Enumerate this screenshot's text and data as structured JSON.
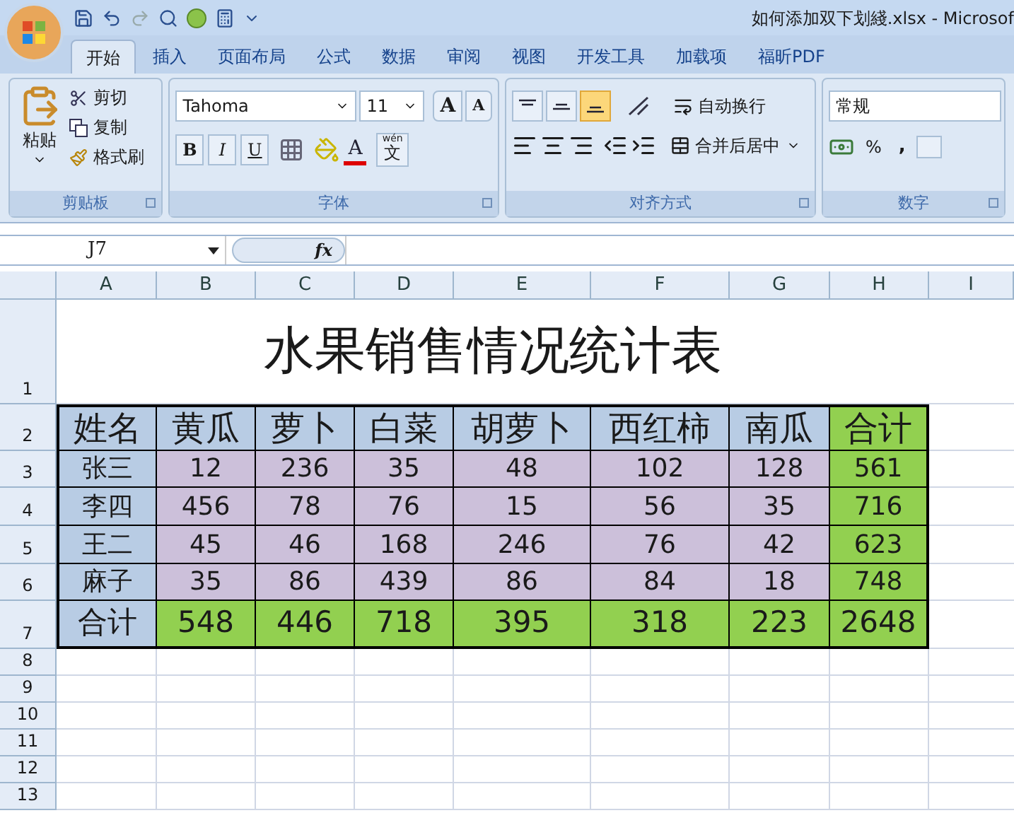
{
  "window": {
    "title": "如何添加双下划綫.xlsx - Microsof"
  },
  "tabs": [
    {
      "label": "开始",
      "selected": true
    },
    {
      "label": "插入",
      "selected": false
    },
    {
      "label": "页面布局",
      "selected": false
    },
    {
      "label": "公式",
      "selected": false
    },
    {
      "label": "数据",
      "selected": false
    },
    {
      "label": "审阅",
      "selected": false
    },
    {
      "label": "视图",
      "selected": false
    },
    {
      "label": "开发工具",
      "selected": false
    },
    {
      "label": "加载项",
      "selected": false
    },
    {
      "label": "福昕PDF",
      "selected": false
    }
  ],
  "clipboard": {
    "label": "剪贴板",
    "paste": "粘贴",
    "cut": "剪切",
    "copy": "复制",
    "format_painter": "格式刷"
  },
  "font": {
    "label": "字体",
    "font_name": "Tahoma",
    "font_size": "11",
    "grow": "A",
    "shrink": "A",
    "bold": "B",
    "italic": "I",
    "underline": "U",
    "font_color": "A",
    "phonetic_top": "wén",
    "phonetic": "文"
  },
  "alignment": {
    "label": "对齐方式",
    "vertical": [
      {
        "kind": "top",
        "selected": false
      },
      {
        "kind": "middle",
        "selected": false
      },
      {
        "kind": "bottom",
        "selected": true
      }
    ],
    "wrap_text": "自动换行",
    "merge_center": "合并后居中"
  },
  "number": {
    "label": "数字",
    "format": "常规",
    "percent": "%",
    "comma": ","
  },
  "formula_bar": {
    "name_box": "J7",
    "fx": "fx"
  },
  "columns": [
    "A",
    "B",
    "C",
    "D",
    "E",
    "F",
    "G",
    "H",
    "I"
  ],
  "sheet": {
    "title": "水果销售情况统计表",
    "rows": [
      {
        "kind": "header",
        "cells": [
          "姓名",
          "黄瓜",
          "萝卜",
          "白菜",
          "胡萝卜",
          "西红柿",
          "南瓜",
          "合计"
        ]
      },
      {
        "kind": "data",
        "cells": [
          "张三",
          "12",
          "236",
          "35",
          "48",
          "102",
          "128",
          "561"
        ]
      },
      {
        "kind": "data",
        "cells": [
          "李四",
          "456",
          "78",
          "76",
          "15",
          "56",
          "35",
          "716"
        ]
      },
      {
        "kind": "data",
        "cells": [
          "王二",
          "45",
          "46",
          "168",
          "246",
          "76",
          "42",
          "623"
        ]
      },
      {
        "kind": "data",
        "cells": [
          "麻子",
          "35",
          "86",
          "439",
          "86",
          "84",
          "18",
          "748"
        ]
      },
      {
        "kind": "total",
        "cells": [
          "合计",
          "548",
          "446",
          "718",
          "395",
          "318",
          "223",
          "2648"
        ]
      }
    ]
  },
  "row_numbers": [
    "1",
    "2",
    "3",
    "4",
    "5",
    "6",
    "7",
    "8",
    "9",
    "10",
    "11",
    "12",
    "13"
  ]
}
